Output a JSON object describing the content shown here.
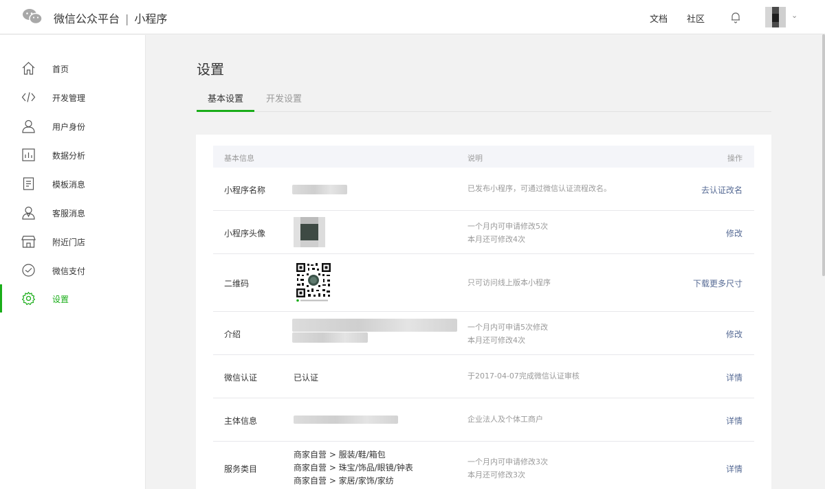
{
  "header": {
    "brand": "微信公众平台",
    "separator": "|",
    "product": "小程序",
    "links": [
      "文档",
      "社区"
    ],
    "icons": [
      "wechat-logo-icon",
      "bell-icon",
      "chevron-down-icon"
    ]
  },
  "sidebar": {
    "items": [
      {
        "label": "首页",
        "icon": "home-icon",
        "active": false
      },
      {
        "label": "开发管理",
        "icon": "code-icon",
        "active": false
      },
      {
        "label": "用户身份",
        "icon": "user-icon",
        "active": false
      },
      {
        "label": "数据分析",
        "icon": "chart-icon",
        "active": false
      },
      {
        "label": "模板消息",
        "icon": "document-icon",
        "active": false
      },
      {
        "label": "客服消息",
        "icon": "customer-service-icon",
        "active": false
      },
      {
        "label": "附近门店",
        "icon": "store-icon",
        "active": false
      },
      {
        "label": "微信支付",
        "icon": "pay-icon",
        "active": false
      },
      {
        "label": "设置",
        "icon": "gear-icon",
        "active": true
      }
    ],
    "active_color": "#1aad19"
  },
  "main": {
    "title": "设置",
    "tabs": [
      {
        "label": "基本设置",
        "active": true
      },
      {
        "label": "开发设置",
        "active": false
      }
    ],
    "table": {
      "headers": [
        "基本信息",
        "说明",
        "操作"
      ],
      "rows": [
        {
          "name": "小程序名称",
          "value": "",
          "desc": [
            "已发布小程序，可通过微信认证流程改名。"
          ],
          "op": "去认证改名"
        },
        {
          "name": "小程序头像",
          "value": "",
          "desc": [
            "一个月内可申请修改5次",
            "本月还可修改4次"
          ],
          "op": "修改"
        },
        {
          "name": "二维码",
          "value": "",
          "desc": [
            "只可访问线上版本小程序"
          ],
          "op": "下载更多尺寸"
        },
        {
          "name": "介绍",
          "value": "",
          "desc": [
            "一个月内可申请5次修改",
            "本月还可修改4次"
          ],
          "op": "修改"
        },
        {
          "name": "微信认证",
          "value": "已认证",
          "desc": [
            "于2017-04-07完成微信认证审核"
          ],
          "op": "详情"
        },
        {
          "name": "主体信息",
          "value": "",
          "desc": [
            "企业法人及个体工商户"
          ],
          "op": "详情"
        },
        {
          "name": "服务类目",
          "value": [
            "商家自营 > 服装/鞋/箱包",
            "商家自营 > 珠宝/饰品/眼镜/钟表",
            "商家自营 > 家居/家饰/家纺"
          ],
          "desc": [
            "一个月内可申请修改3次",
            "本月还可修改3次"
          ],
          "op": "详情"
        }
      ]
    },
    "link_color": "#576b95"
  }
}
